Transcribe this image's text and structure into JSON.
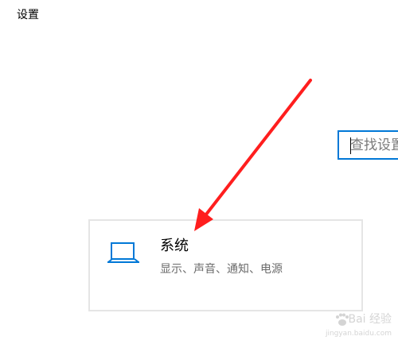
{
  "window": {
    "title": "设置"
  },
  "search": {
    "placeholder": "查找设置"
  },
  "tiles": [
    {
      "title": "系统",
      "subtitle": "显示、声音、通知、电源",
      "icon": "laptop-icon"
    }
  ],
  "watermark": {
    "text": "Bai 经验",
    "subtext": "jingyan.baidu.com"
  },
  "colors": {
    "accent": "#0078d7",
    "annotation_arrow": "#ff1e1e",
    "tile_border": "#e5e5e5",
    "subtitle": "#6b6b6b"
  }
}
